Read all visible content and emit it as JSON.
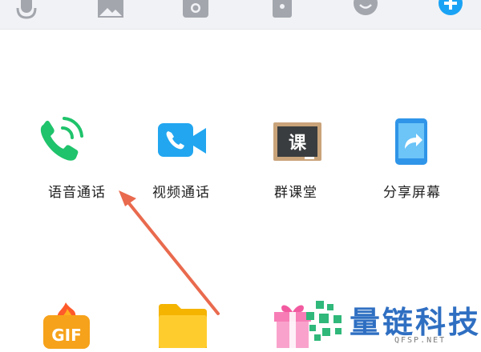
{
  "toolbar": {
    "icons": [
      "microphone-icon",
      "image-icon",
      "camera-icon",
      "red-packet-icon",
      "emoji-icon",
      "plus-icon"
    ]
  },
  "grid": {
    "row1": [
      {
        "label": "语音通话",
        "icon": "phone-call-icon"
      },
      {
        "label": "视频通话",
        "icon": "video-call-icon"
      },
      {
        "label": "群课堂",
        "icon": "blackboard-icon"
      },
      {
        "label": "分享屏幕",
        "icon": "share-screen-icon"
      }
    ],
    "row2": [
      {
        "icon": "gif-icon"
      },
      {
        "icon": "folder-icon"
      },
      {
        "icon": "gift-icon"
      }
    ],
    "blackboard_text": "课",
    "gif_text": "GIF"
  },
  "colors": {
    "phone_green": "#1fc36b",
    "video_blue": "#22a6f0",
    "arrow": "#e96a4e",
    "watermark": "#2f6fc2"
  },
  "watermark": {
    "title": "量链科技",
    "sub": "QFSP.NET"
  }
}
